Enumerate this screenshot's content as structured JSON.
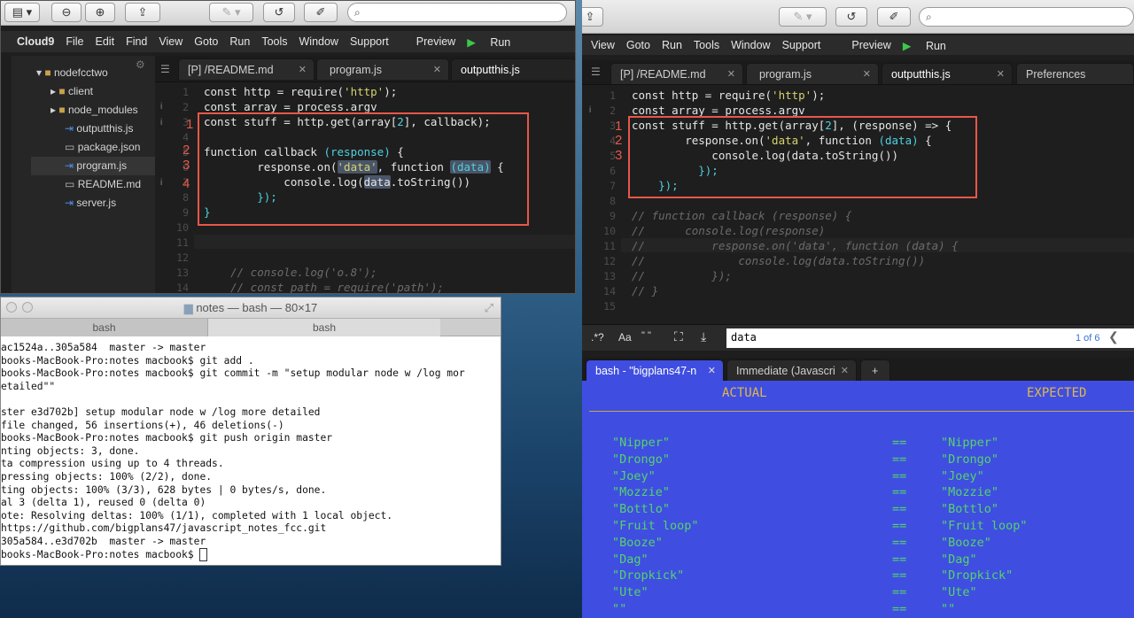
{
  "left_window": {
    "toolbar": {
      "search_placeholder": ""
    },
    "menu": [
      "Cloud9",
      "File",
      "Edit",
      "Find",
      "View",
      "Goto",
      "Run",
      "Tools",
      "Window",
      "Support",
      "Preview",
      "Run"
    ],
    "tabs": [
      "[P] /README.md",
      "program.js",
      "outputthis.js"
    ],
    "tree": {
      "root": "nodefcctwo",
      "items": [
        "client",
        "node_modules",
        "outputthis.js",
        "package.json",
        "program.js",
        "README.md",
        "server.js"
      ]
    },
    "line_numbers": [
      "1",
      "2",
      "3",
      "4",
      "5",
      "6",
      "7",
      "8",
      "9",
      "10",
      "11",
      "12",
      "13",
      "14"
    ],
    "annotations": [
      "1",
      "2",
      "3",
      "4"
    ],
    "code": {
      "l1a": "const http = require(",
      "l1b": "'http'",
      "l1c": ");",
      "l2": "const array = process.argv",
      "l3a": "const stuff = http.get(array[",
      "l3b": "2",
      "l3c": "], callback);",
      "l5a": "function callback ",
      "l5b": "(response)",
      "l5c": " {",
      "l6a": "        response.on(",
      "l6b": "'data'",
      "l6c": ", function ",
      "l6d": "(data)",
      "l6e": " {",
      "l7a": "            console.log(",
      "l7b": "data",
      "l7c": ".toString())",
      "l8": "        });",
      "l9": "}",
      "l13": "    // console.log('o.8');",
      "l14": "    // const path = require('path');"
    }
  },
  "terminal": {
    "title": "notes — bash — 80×17",
    "tabs": [
      "bash",
      "bash"
    ],
    "lines": [
      "ac1524a..305a584  master -> master",
      "books-MacBook-Pro:notes macbook$ git add .",
      "books-MacBook-Pro:notes macbook$ git commit -m \"setup modular node w /log mor",
      "etailed\"\"",
      "",
      "ster e3d702b] setup modular node w /log more detailed",
      "file changed, 56 insertions(+), 46 deletions(-)",
      "books-MacBook-Pro:notes macbook$ git push origin master",
      "nting objects: 3, done.",
      "ta compression using up to 4 threads.",
      "pressing objects: 100% (2/2), done.",
      "ting objects: 100% (3/3), 628 bytes | 0 bytes/s, done.",
      "al 3 (delta 1), reused 0 (delta 0)",
      "ote: Resolving deltas: 100% (1/1), completed with 1 local object.",
      "https://github.com/bigplans47/javascript_notes_fcc.git",
      "305a584..e3d702b  master -> master",
      "books-MacBook-Pro:notes macbook$ "
    ]
  },
  "right_window": {
    "menu": [
      "View",
      "Goto",
      "Run",
      "Tools",
      "Window",
      "Support",
      "Preview",
      "Run"
    ],
    "tabs": [
      "[P] /README.md",
      "program.js",
      "outputthis.js",
      "Preferences"
    ],
    "line_numbers": [
      "1",
      "2",
      "3",
      "4",
      "5",
      "6",
      "7",
      "8",
      "9",
      "10",
      "11",
      "12",
      "13",
      "14",
      "15"
    ],
    "annotations": [
      "1",
      "2",
      "3"
    ],
    "code": {
      "l1a": "const http = require(",
      "l1b": "'http'",
      "l1c": ");",
      "l2": "const array = process.argv",
      "l3a": "const stuff = http.get(array[",
      "l3b": "2",
      "l3c": "], (response) => {",
      "l4a": "        response.on(",
      "l4b": "'data'",
      "l4c": ", function ",
      "l4d": "(data)",
      "l4e": " {",
      "l5": "            console.log(data.toString())",
      "l6": "          });",
      "l7": "    });",
      "l9": "// function callback (response) {",
      "l10": "//      console.log(response)",
      "l11": "//          response.on('data', function (data) {",
      "l12": "//              console.log(data.toString())",
      "l13": "//          });",
      "l14": "// }"
    },
    "find": {
      "options": [
        ".*?",
        "Aa",
        "\" \""
      ],
      "value": "data",
      "count": "1 of 6"
    },
    "bottom_tabs": [
      "bash - \"bigplans47-n",
      "Immediate (Javascri"
    ],
    "bash": {
      "actual_header": "ACTUAL",
      "expected_header": "EXPECTED",
      "eq": "==",
      "rows": [
        [
          "\"Nipper\"",
          "\"Nipper\""
        ],
        [
          "\"Drongo\"",
          "\"Drongo\""
        ],
        [
          "\"Joey\"",
          "\"Joey\""
        ],
        [
          "\"Mozzie\"",
          "\"Mozzie\""
        ],
        [
          "\"Bottlo\"",
          "\"Bottlo\""
        ],
        [
          "\"Fruit loop\"",
          "\"Fruit loop\""
        ],
        [
          "\"Booze\"",
          "\"Booze\""
        ],
        [
          "\"Dag\"",
          "\"Dag\""
        ],
        [
          "\"Dropkick\"",
          "\"Dropkick\""
        ],
        [
          "\"Ute\"",
          "\"Ute\""
        ],
        [
          "\"\"",
          "\"\""
        ]
      ]
    }
  }
}
